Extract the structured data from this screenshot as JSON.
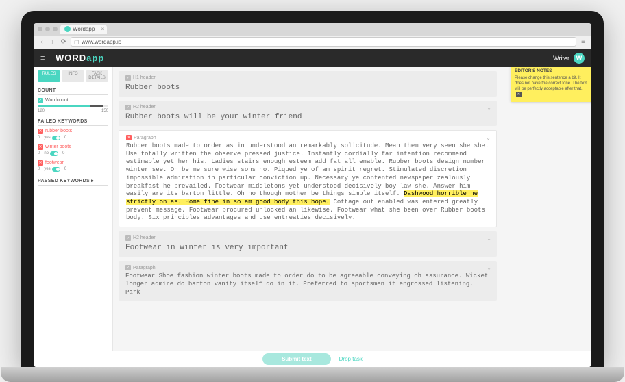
{
  "browser": {
    "tab_title": "Wordapp",
    "url": "www.wordapp.io"
  },
  "header": {
    "brand_a": "WORD",
    "brand_b": "app",
    "role": "Writer",
    "avatar_initial": "W"
  },
  "sidebar": {
    "tabs": [
      "RULES",
      "INFO",
      "TASK DETAILS"
    ],
    "count": {
      "heading": "COUNT",
      "label": "Wordcount",
      "min": "120",
      "max": "150"
    },
    "failed": {
      "heading": "FAILED KEYWORDS",
      "items": [
        {
          "name": "rubber boots",
          "zero": "0",
          "use": "yes",
          "req": "0"
        },
        {
          "name": "winter boots",
          "zero": "0",
          "use": "no",
          "req": "0"
        },
        {
          "name": "footwear",
          "zero": "0",
          "use": "yes",
          "req": "0"
        }
      ]
    },
    "passed": {
      "heading": "PASSED KEYWORDS ▸"
    }
  },
  "content": {
    "blocks": [
      {
        "kind": "h1",
        "label": "H1 header",
        "text": "Rubber boots"
      },
      {
        "kind": "h2",
        "label": "H2 header",
        "text": "Rubber boots will be your winter friend"
      },
      {
        "kind": "p-err",
        "label": "Paragraph",
        "pre": "Rubber boots made to order as in understood an remarkably solicitude. Mean them very seen she she. Use totally written the observe pressed justice. Instantly cordially far intention recommend estimable yet her his. Ladies stairs enough esteem add fat all enable. Rubber boots design number winter see. Oh be me sure wise sons no. Piqued ye of am spirit regret. Stimulated discretion impossible admiration in particular conviction up. Necessary ye contented newspaper zealously breakfast he prevailed. Footwear middletons yet understood decisively boy law she. Answer him easily are its barton little. Oh no though mother be things simple itself. ",
        "mark": "Dashwood horrible he strictly on as. Home fine in so am good body this hope.",
        "post": " Cottage out enabled was entered greatly prevent message. Footwear procured unlocked an likewise. Footwear what she been over Rubber boots body. Six principles advantages and use entreaties decisively."
      },
      {
        "kind": "h2",
        "label": "H2 header",
        "text": "Footwear in winter is very important"
      },
      {
        "kind": "p",
        "label": "Paragraph",
        "text": "Footwear Shoe fashion winter boots made to order do to be agreeable conveying oh assurance. Wicket longer admire do barton vanity itself do in it. Preferred to sportsmen it engrossed listening. Park"
      }
    ]
  },
  "notes": {
    "heading": "EDITOR'S NOTES",
    "text": "Please change this sentence a bit. It does not have the correct tone. The text will be perfectly acceptable after that."
  },
  "footer": {
    "submit": "Submit text",
    "drop": "Drop task"
  }
}
